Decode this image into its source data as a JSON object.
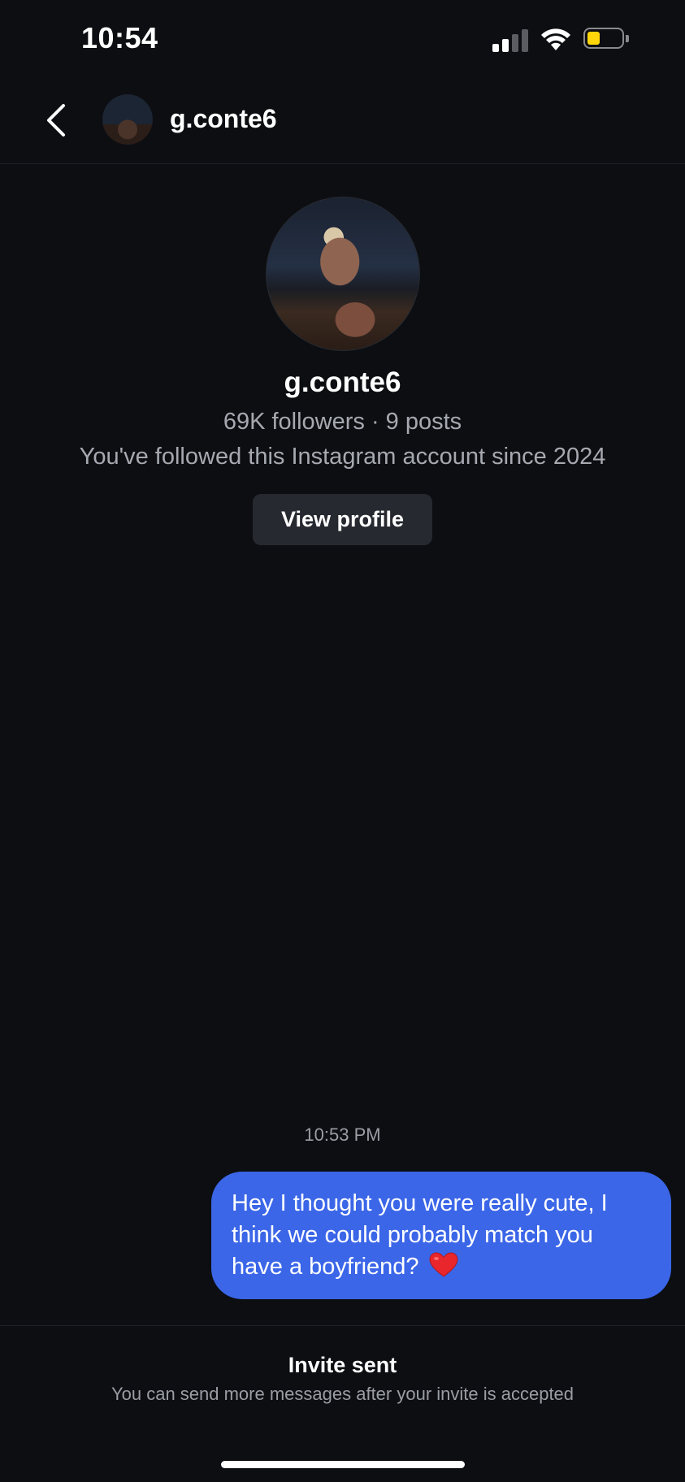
{
  "status_bar": {
    "time": "10:54",
    "icons": [
      "cellular-signal-icon",
      "wifi-icon",
      "battery-icon"
    ],
    "battery_color": "#ffd60a"
  },
  "header": {
    "back_icon": "chevron-left-icon",
    "username": "g.conte6"
  },
  "profile": {
    "name": "g.conte6",
    "stats": "69K followers · 9 posts",
    "follow_note": "You've followed this Instagram account since 2024",
    "view_profile_label": "View profile"
  },
  "conversation": {
    "timestamp": "10:53 PM",
    "messages": [
      {
        "direction": "outgoing",
        "text": "Hey I thought you were really cute, I think we could probably match you have a boyfriend?",
        "emoji": "heart-icon",
        "bubble_color": "#3b66e8"
      }
    ]
  },
  "footer": {
    "title": "Invite sent",
    "subtitle": "You can send more messages after your invite is accepted"
  }
}
